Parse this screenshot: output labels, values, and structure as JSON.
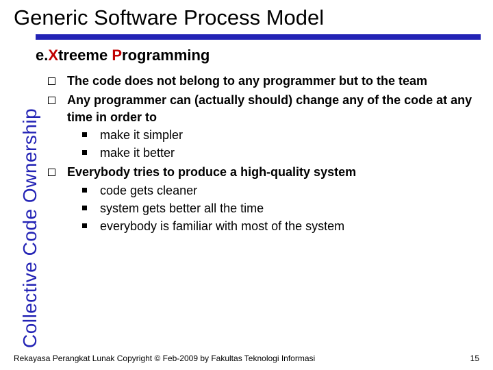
{
  "header": {
    "title": "Generic Software Process Model"
  },
  "sidebar": {
    "label": "Collective Code Ownership"
  },
  "subtitle": {
    "prefix_e": "e.",
    "x": "X",
    "treeme": "treeme ",
    "p": "P",
    "rogramming": "rogramming"
  },
  "bullets": [
    {
      "text": "The code does not belong to any programmer but to the team",
      "sub": []
    },
    {
      "text": "Any programmer can (actually should) change any of the code at any time in order to",
      "sub": [
        "make it simpler",
        "make it better"
      ]
    },
    {
      "text": "Everybody tries to produce a high-quality system",
      "sub": [
        "code gets cleaner",
        "system gets better all the time",
        "everybody is familiar with most of the system"
      ]
    }
  ],
  "footer": {
    "left": "Rekayasa Perangkat Lunak Copyright © Feb-2009 by Fakultas Teknologi Informasi",
    "right": "15"
  }
}
